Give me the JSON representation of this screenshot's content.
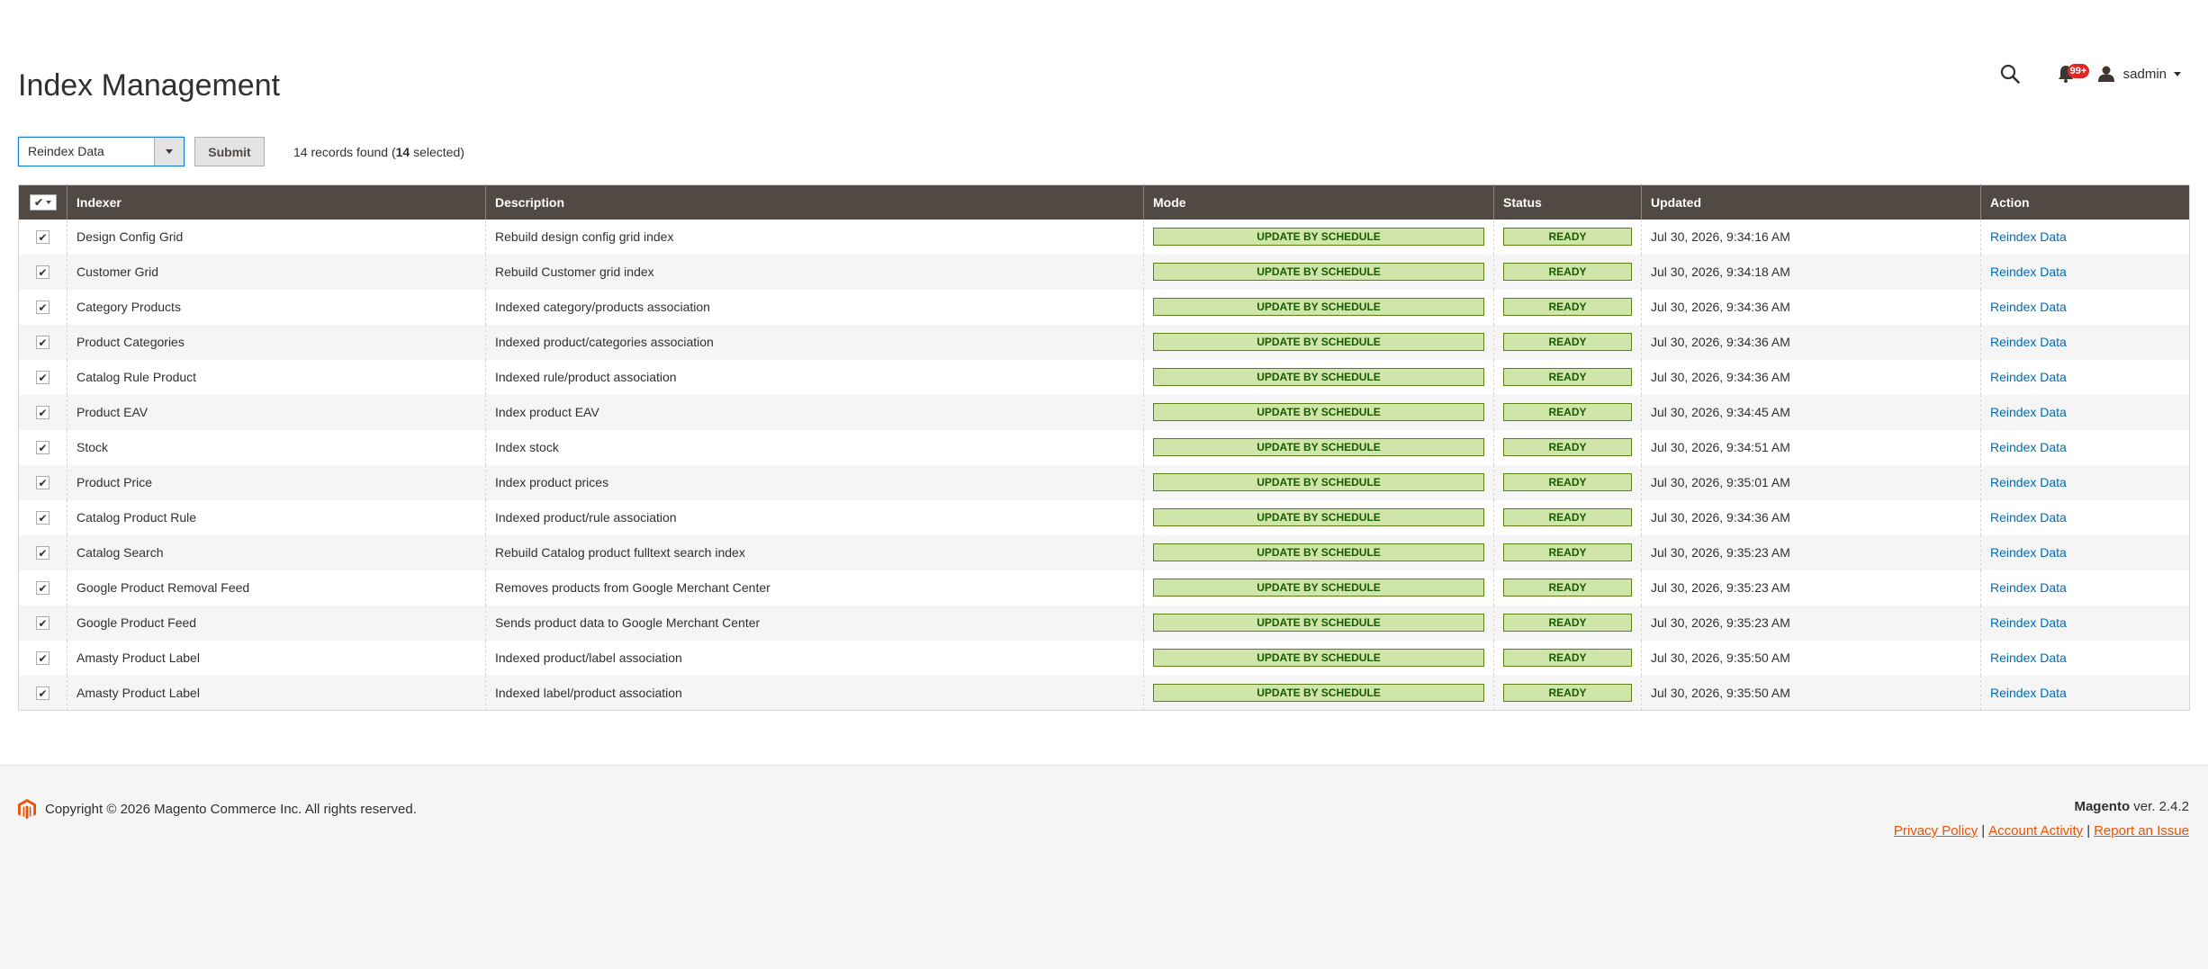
{
  "header": {
    "title": "Index Management",
    "notifications_count": "99+",
    "user_name": "sadmin"
  },
  "toolbar": {
    "mass_action_value": "Reindex Data",
    "submit_label": "Submit",
    "records_prefix": "14 records found (",
    "records_selected": "14",
    "records_suffix": " selected)"
  },
  "grid": {
    "columns": [
      "Indexer",
      "Description",
      "Mode",
      "Status",
      "Updated",
      "Action"
    ],
    "rows": [
      {
        "indexer": "Design Config Grid",
        "description": "Rebuild design config grid index",
        "mode": "UPDATE BY SCHEDULE",
        "status": "READY",
        "updated": "Jul 30, 2026, 9:34:16 AM",
        "action": "Reindex Data"
      },
      {
        "indexer": "Customer Grid",
        "description": "Rebuild Customer grid index",
        "mode": "UPDATE BY SCHEDULE",
        "status": "READY",
        "updated": "Jul 30, 2026, 9:34:18 AM",
        "action": "Reindex Data"
      },
      {
        "indexer": "Category Products",
        "description": "Indexed category/products association",
        "mode": "UPDATE BY SCHEDULE",
        "status": "READY",
        "updated": "Jul 30, 2026, 9:34:36 AM",
        "action": "Reindex Data"
      },
      {
        "indexer": "Product Categories",
        "description": "Indexed product/categories association",
        "mode": "UPDATE BY SCHEDULE",
        "status": "READY",
        "updated": "Jul 30, 2026, 9:34:36 AM",
        "action": "Reindex Data"
      },
      {
        "indexer": "Catalog Rule Product",
        "description": "Indexed rule/product association",
        "mode": "UPDATE BY SCHEDULE",
        "status": "READY",
        "updated": "Jul 30, 2026, 9:34:36 AM",
        "action": "Reindex Data"
      },
      {
        "indexer": "Product EAV",
        "description": "Index product EAV",
        "mode": "UPDATE BY SCHEDULE",
        "status": "READY",
        "updated": "Jul 30, 2026, 9:34:45 AM",
        "action": "Reindex Data"
      },
      {
        "indexer": "Stock",
        "description": "Index stock",
        "mode": "UPDATE BY SCHEDULE",
        "status": "READY",
        "updated": "Jul 30, 2026, 9:34:51 AM",
        "action": "Reindex Data"
      },
      {
        "indexer": "Product Price",
        "description": "Index product prices",
        "mode": "UPDATE BY SCHEDULE",
        "status": "READY",
        "updated": "Jul 30, 2026, 9:35:01 AM",
        "action": "Reindex Data"
      },
      {
        "indexer": "Catalog Product Rule",
        "description": "Indexed product/rule association",
        "mode": "UPDATE BY SCHEDULE",
        "status": "READY",
        "updated": "Jul 30, 2026, 9:34:36 AM",
        "action": "Reindex Data"
      },
      {
        "indexer": "Catalog Search",
        "description": "Rebuild Catalog product fulltext search index",
        "mode": "UPDATE BY SCHEDULE",
        "status": "READY",
        "updated": "Jul 30, 2026, 9:35:23 AM",
        "action": "Reindex Data"
      },
      {
        "indexer": "Google Product Removal Feed",
        "description": "Removes products from Google Merchant Center",
        "mode": "UPDATE BY SCHEDULE",
        "status": "READY",
        "updated": "Jul 30, 2026, 9:35:23 AM",
        "action": "Reindex Data"
      },
      {
        "indexer": "Google Product Feed",
        "description": "Sends product data to Google Merchant Center",
        "mode": "UPDATE BY SCHEDULE",
        "status": "READY",
        "updated": "Jul 30, 2026, 9:35:23 AM",
        "action": "Reindex Data"
      },
      {
        "indexer": "Amasty Product Label",
        "description": "Indexed product/label association",
        "mode": "UPDATE BY SCHEDULE",
        "status": "READY",
        "updated": "Jul 30, 2026, 9:35:50 AM",
        "action": "Reindex Data"
      },
      {
        "indexer": "Amasty Product Label",
        "description": "Indexed label/product association",
        "mode": "UPDATE BY SCHEDULE",
        "status": "READY",
        "updated": "Jul 30, 2026, 9:35:50 AM",
        "action": "Reindex Data"
      }
    ]
  },
  "footer": {
    "copyright": "Copyright © 2026 Magento Commerce Inc. All rights reserved.",
    "brand": "Magento",
    "version": " ver. 2.4.2",
    "links": [
      "Privacy Policy",
      "Account Activity",
      "Report an Issue"
    ]
  },
  "colors": {
    "header_bg": "#514943",
    "badge_bg": "#d0e5a9",
    "badge_text": "#185b00",
    "link": "#006bb4",
    "footer_link": "#eb5202",
    "notification": "#e22626"
  },
  "icons": [
    "search-icon",
    "bell-icon",
    "user-icon",
    "chevron-down-icon",
    "magento-logo-icon",
    "checkbox-checked-icon"
  ]
}
